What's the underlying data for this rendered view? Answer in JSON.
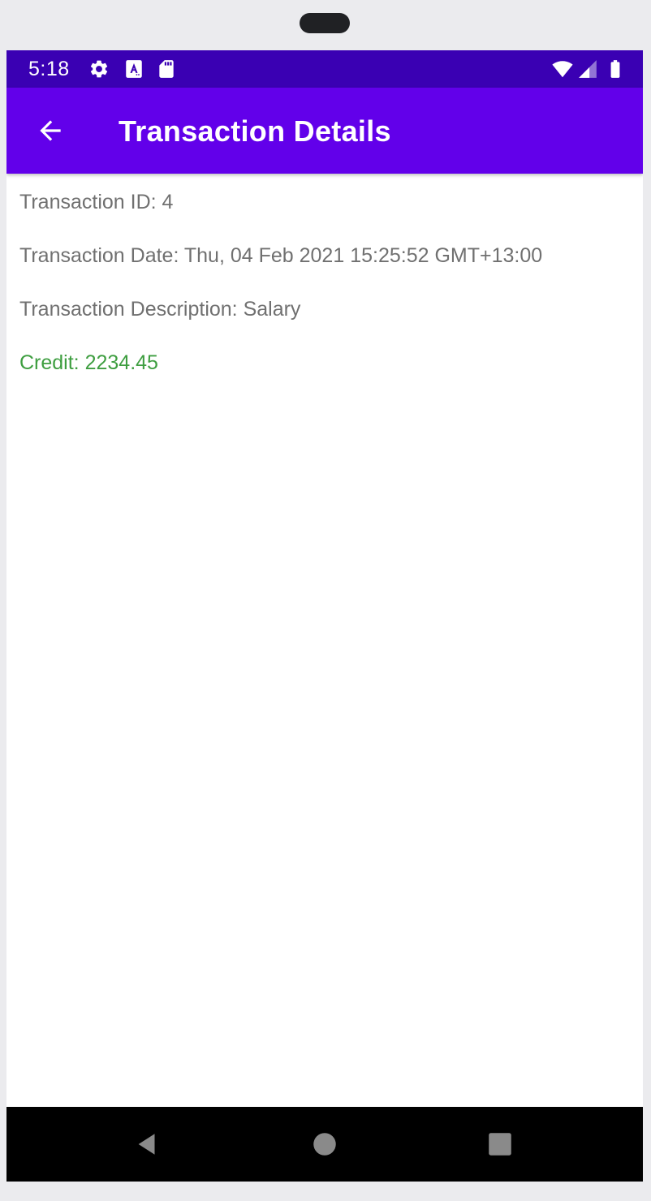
{
  "status_bar": {
    "time": "5:18",
    "left_icons": [
      "gear-icon",
      "a-text-icon",
      "sd-card-icon"
    ],
    "right_icons": [
      "wifi-icon",
      "cell-signal-icon",
      "battery-icon"
    ]
  },
  "app_bar": {
    "back_icon": "arrow-left-icon",
    "title": "Transaction Details",
    "background_color": "#6200ea"
  },
  "transaction": {
    "id_line": "Transaction ID: 4",
    "date_line": "Transaction Date: Thu, 04 Feb 2021 15:25:52 GMT+13:00",
    "description_line": "Transaction Description: Salary",
    "credit_line": "Credit: 2234.45",
    "credit_color": "#3e9e40"
  },
  "nav_bar": {
    "buttons": [
      "back-triangle-icon",
      "home-circle-icon",
      "recents-square-icon"
    ]
  }
}
